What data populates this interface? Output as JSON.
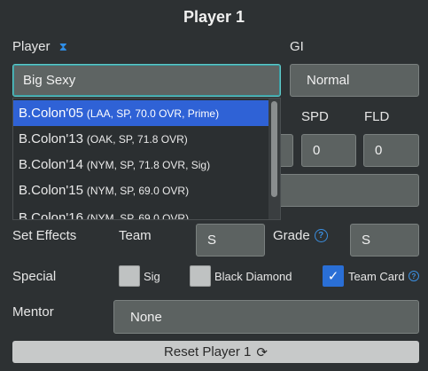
{
  "panel": {
    "title": "Player 1"
  },
  "player": {
    "label": "Player",
    "icon": "hourglass-icon",
    "value": "Big Sexy"
  },
  "gi": {
    "label": "GI",
    "value": "Normal"
  },
  "stats": {
    "spd_label": "SPD",
    "spd_value": "0",
    "fld_label": "FLD",
    "fld_value": "0"
  },
  "dropdown": {
    "options": [
      {
        "name": "B.Colon'05",
        "detail": "(LAA, SP, 70.0 OVR, Prime)",
        "selected": true
      },
      {
        "name": "B.Colon'13",
        "detail": "(OAK, SP, 71.8 OVR)"
      },
      {
        "name": "B.Colon'14",
        "detail": "(NYM, SP, 71.8 OVR, Sig)"
      },
      {
        "name": "B.Colon'15",
        "detail": "(NYM, SP, 69.0 OVR)"
      },
      {
        "name": "B.Colon'16",
        "detail": "(NYM, SP, 69.0 OVR)"
      }
    ]
  },
  "set_effects": {
    "label": "Set Effects",
    "team_label": "Team",
    "team_value": "S",
    "grade_label": "Grade",
    "grade_value": "S"
  },
  "special": {
    "label": "Special",
    "sig_label": "Sig",
    "sig_checked": false,
    "black_diamond_label": "Black Diamond",
    "black_diamond_checked": false,
    "team_card_label": "Team Card",
    "team_card_checked": true
  },
  "mentor": {
    "label": "Mentor",
    "value": "None"
  },
  "reset": {
    "label": "Reset Player 1",
    "icon": "refresh-icon"
  },
  "colors": {
    "accent": "#2f62d6",
    "focus": "#5ec8c8",
    "help": "#3b8fe0"
  }
}
